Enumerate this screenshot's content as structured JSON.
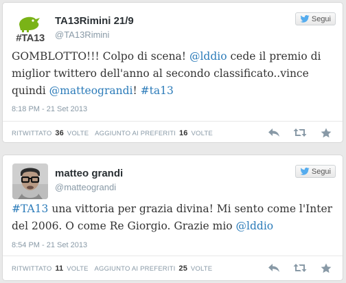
{
  "tweets": [
    {
      "name": "TA13Rimini 21/9",
      "handle": "@TA13Rimini",
      "follow_label": "Segui",
      "avatar_text": "#TA13",
      "text": {
        "p1": "GOMBLOTTO!!! Colpo di scena! ",
        "m1": "@lddio",
        "p2": " cede il premio di miglior twittero dell'anno al secondo classificato..vince quindi ",
        "m2": "@matteograndi",
        "p3": "! ",
        "h1": "#ta13"
      },
      "time": "8:18 PM - 21 Set 2013",
      "retweet_label": "RITWITTATO",
      "retweet_count": "36",
      "retweet_unit": "VOLTE",
      "fav_label": "AGGIUNTO AI PREFERITI",
      "fav_count": "16",
      "fav_unit": "VOLTE"
    },
    {
      "name": "matteo grandi",
      "handle": "@matteograndi",
      "follow_label": "Segui",
      "text": {
        "h1": "#TA13",
        "p1": " una vittoria per grazia divina! Mi sento come l'Inter del 2006. O come Re Giorgio. Grazie mio ",
        "m1": "@lddio"
      },
      "time": "8:54 PM - 21 Set 2013",
      "retweet_label": "RITWITTATO",
      "retweet_count": "11",
      "retweet_unit": "VOLTE",
      "fav_label": "AGGIUNTO AI PREFERITI",
      "fav_count": "25",
      "fav_unit": "VOLTE"
    }
  ],
  "colors": {
    "link": "#2b7bb9",
    "ta13_green": "#7ab317",
    "muted": "#8899a6"
  },
  "icons": [
    "twitter-bird-icon",
    "reply-icon",
    "retweet-icon",
    "favorite-star-icon"
  ]
}
